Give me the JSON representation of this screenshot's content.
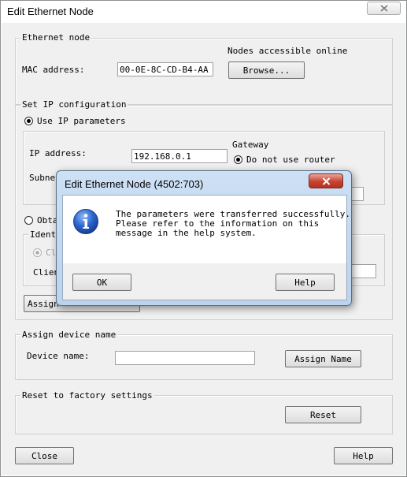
{
  "window": {
    "title": "Edit Ethernet Node"
  },
  "ethernet_node": {
    "group_label": "Ethernet node",
    "online_label": "Nodes accessible online",
    "mac_label": "MAC address:",
    "mac_value": "00-0E-8C-CD-B4-AA",
    "browse_label": "Browse..."
  },
  "ip_config": {
    "group_label": "Set IP configuration",
    "use_ip_label": "Use IP parameters",
    "ip_label": "IP address:",
    "ip_value": "192.168.0.1",
    "subnet_label": "Subnet",
    "gateway_label": "Gateway",
    "no_router_label": "Do not use router",
    "obtain_label": "Obta",
    "identify_label": "Identi",
    "client_id_radio_label": "Cl",
    "client_label": "Clien",
    "assign_ip_label": "Assign"
  },
  "device_name": {
    "group_label": "Assign device name",
    "name_label": "Device name:",
    "name_value": "",
    "assign_label": "Assign Name"
  },
  "factory": {
    "group_label": "Reset to factory settings",
    "reset_label": "Reset"
  },
  "footer": {
    "close_label": "Close",
    "help_label": "Help"
  },
  "dialog": {
    "title": "Edit Ethernet Node  (4502:703)",
    "line1": "The parameters were transferred successfully.",
    "line2": "Please refer to the information on this",
    "line3": "message in the help system.",
    "ok_label": "OK",
    "help_label": "Help",
    "icon": "info-icon"
  }
}
